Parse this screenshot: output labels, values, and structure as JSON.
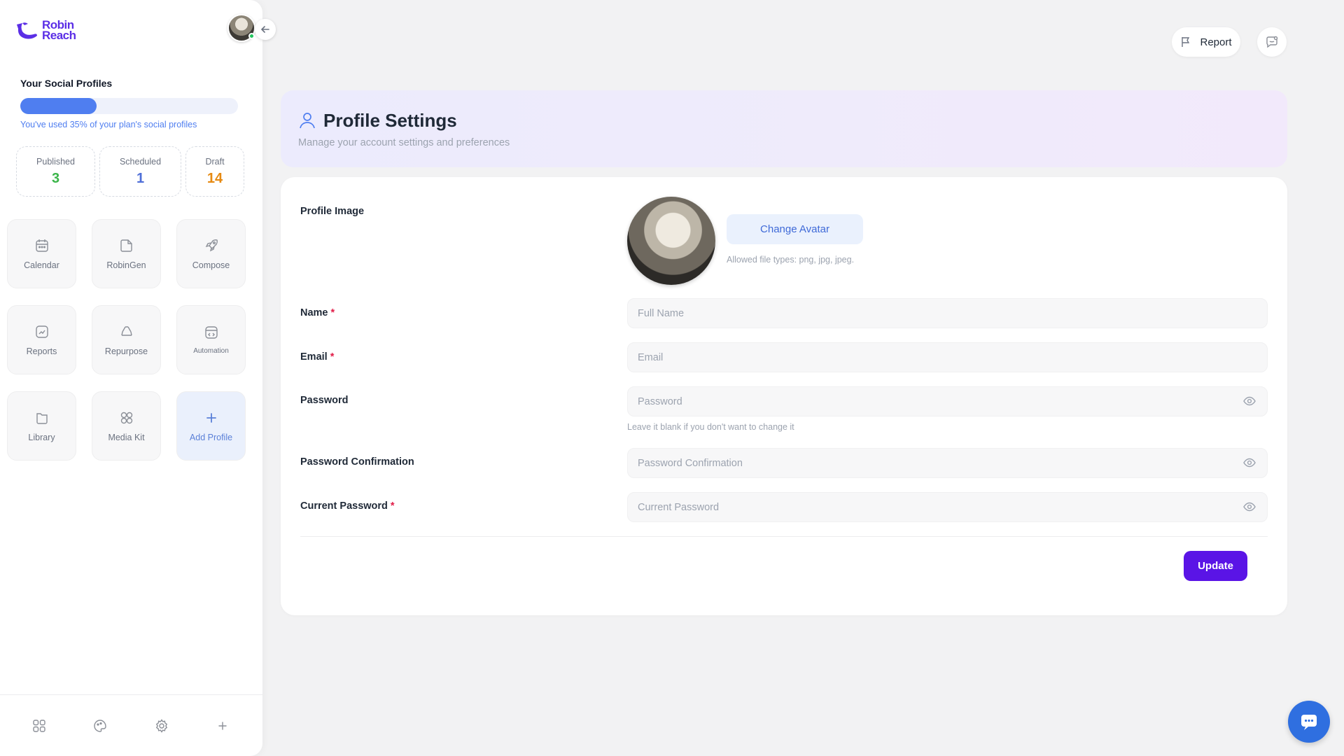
{
  "brand": {
    "name_line1": "Robin",
    "name_line2": "Reach",
    "color": "#5b2ee6"
  },
  "sidebar": {
    "social_profiles_title": "Your Social Profiles",
    "usage_percent": 35,
    "usage_note": "You've used 35% of your plan's social profiles",
    "stats": [
      {
        "label": "Published",
        "value": "3",
        "color": "#3bb54a"
      },
      {
        "label": "Scheduled",
        "value": "1",
        "color": "#4f6fd8"
      },
      {
        "label": "Draft",
        "value": "14",
        "color": "#e68a12"
      }
    ],
    "tiles": [
      {
        "label": "Calendar",
        "icon": "calendar-icon"
      },
      {
        "label": "RobinGen",
        "icon": "robingen-icon"
      },
      {
        "label": "Compose",
        "icon": "rocket-icon"
      },
      {
        "label": "Reports",
        "icon": "reports-icon"
      },
      {
        "label": "Repurpose",
        "icon": "recycle-icon"
      },
      {
        "label": "Automation",
        "icon": "automation-icon"
      },
      {
        "label": "Library",
        "icon": "folder-icon"
      },
      {
        "label": "Media Kit",
        "icon": "grid-circles-icon"
      },
      {
        "label": "Add Profile",
        "icon": "plus-icon"
      }
    ],
    "bottom_icons": [
      "grid-icon",
      "palette-icon",
      "gear-icon",
      "plus-icon"
    ]
  },
  "topbar": {
    "report_label": "Report"
  },
  "header": {
    "title": "Profile Settings",
    "subtitle": "Manage your account settings and preferences"
  },
  "form": {
    "profile_image_label": "Profile Image",
    "change_avatar_label": "Change Avatar",
    "allowed_types": "Allowed file types: png, jpg, jpeg.",
    "name_label": "Name",
    "name_placeholder": "Full Name",
    "email_label": "Email",
    "email_placeholder": "Email",
    "password_label": "Password",
    "password_placeholder": "Password",
    "password_hint": "Leave it blank if you don't want to change it",
    "password_confirmation_label": "Password Confirmation",
    "password_confirmation_placeholder": "Password Confirmation",
    "current_password_label": "Current Password",
    "current_password_placeholder": "Current Password",
    "required_mark": "*",
    "update_label": "Update"
  },
  "colors": {
    "accent": "#5a14e6",
    "progress": "#4f7ef0",
    "chat": "#2f6fe0"
  }
}
